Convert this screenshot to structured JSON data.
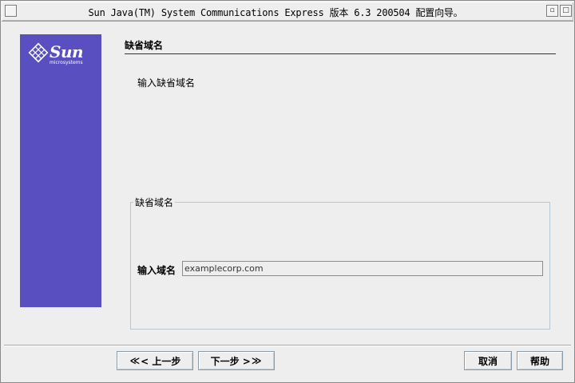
{
  "window": {
    "title": "Sun Java(TM) System Communications Express 版本 6.3 200504 配置向导。",
    "minimize_glyph": "▫",
    "maximize_glyph": "□"
  },
  "sidebar": {
    "brand": "Sun",
    "brand_sub": "microsystems",
    "background": "#5a4fc0"
  },
  "page": {
    "title": "缺省域名",
    "instruction": "输入缺省域名"
  },
  "group": {
    "legend": "缺省域名",
    "field_label": "输入域名",
    "field_value": "examplecorp.com"
  },
  "buttons": {
    "back_arrow": "≪",
    "back": "< 上一步",
    "next": "下一步 >",
    "next_arrow": "≫",
    "cancel": "取消",
    "help": "帮助"
  }
}
